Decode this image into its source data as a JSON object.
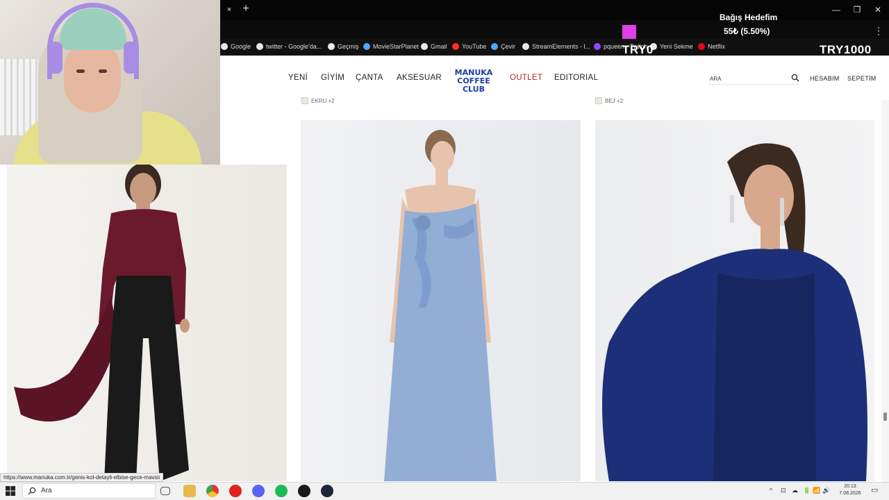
{
  "browser": {
    "tab_close": "×",
    "tab_new": "+",
    "window_controls": [
      "—",
      "❐",
      "✕"
    ],
    "menu": "⋮",
    "bookmarks": [
      {
        "label": "Google",
        "color": "#e8e8e8"
      },
      {
        "label": "twitter - Google'da...",
        "color": "#e8e8e8"
      },
      {
        "label": "Geçmiş",
        "color": "#e8e8e8"
      },
      {
        "label": "MovieStarPlanet",
        "color": "#4ea6ff"
      },
      {
        "label": "Gmail",
        "color": "#e8e8e8"
      },
      {
        "label": "YouTube",
        "color": "#ff2b2b"
      },
      {
        "label": "Çevir",
        "color": "#4ea6ff"
      },
      {
        "label": "StreamElements - l...",
        "color": "#e8e8e8"
      },
      {
        "label": "pqueen - Twitch",
        "color": "#9147ff"
      },
      {
        "label": "Yeni Sekme",
        "color": "#e8e8e8"
      },
      {
        "label": "Netflix",
        "color": "#e50914"
      }
    ]
  },
  "stream_overlay": {
    "goal_title": "Bağış Hedefim",
    "goal_value": "55₺ (5.50%)",
    "goal_color": "#e040e8",
    "code_left": "TRY0",
    "code_right": "TRY1000"
  },
  "site": {
    "nav": [
      "YENİ",
      "GİYİM",
      "ÇANTA",
      "AKSESUAR",
      "OUTLET",
      "EDITORIAL"
    ],
    "logo_line1": "MANUKA",
    "logo_line2": "COFFEE CLUB",
    "search_placeholder": "ARA",
    "account": "HESABIM",
    "cart": "SEPETİM",
    "swatch_left": "EKRU +2",
    "swatch_right": "BEJ +2",
    "outlet_color": "#b3261e",
    "logo_color": "#1c3f9e"
  },
  "products": [
    {
      "name": "burgundy-draped-top-outfit",
      "main_color": "#6b1a2e"
    },
    {
      "name": "light-blue-ruffle-dress",
      "main_color": "#93aed4"
    },
    {
      "name": "navy-cape-dress",
      "main_color": "#1d2f78"
    }
  ],
  "status_url": "https://www.manuka.com.tr/genis-kol-detayli-elbise-gece-mavisi",
  "taskbar": {
    "search_text": "Ara",
    "clock_time": "20:13",
    "clock_date": "7.08.2026",
    "tray_icons": [
      "^",
      "⊡",
      "☁",
      "🔋",
      "📶",
      "🔊"
    ],
    "notification": "▭"
  }
}
